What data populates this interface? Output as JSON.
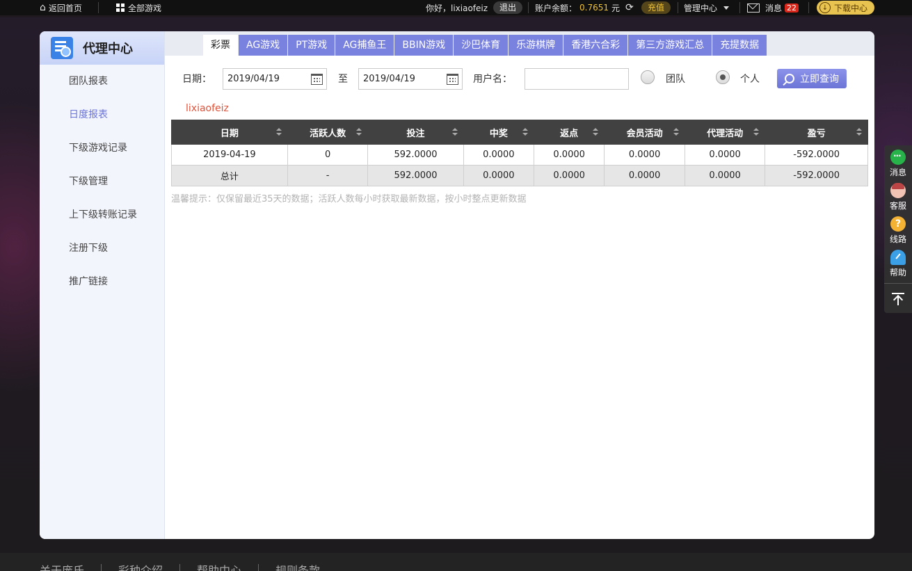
{
  "topbar": {
    "home_label": "返回首页",
    "all_games_label": "全部游戏",
    "greeting": "你好，lixiaofeiz",
    "logout_label": "退出",
    "balance_label": "账户余额：",
    "balance_value": "0.7651",
    "balance_unit": "元",
    "recharge_label": "充值",
    "manage_label": "管理中心",
    "messages_label": "消息",
    "messages_count": "22",
    "download_label": "下载中心"
  },
  "sidebar": {
    "title": "代理中心",
    "items": [
      {
        "label": "团队报表"
      },
      {
        "label": "日度报表"
      },
      {
        "label": "下级游戏记录"
      },
      {
        "label": "下级管理"
      },
      {
        "label": "上下级转账记录"
      },
      {
        "label": "注册下级"
      },
      {
        "label": "推广链接"
      }
    ],
    "active_index": 1
  },
  "tabs": [
    {
      "label": "彩票"
    },
    {
      "label": "AG游戏"
    },
    {
      "label": "PT游戏"
    },
    {
      "label": "AG捕鱼王"
    },
    {
      "label": "BBIN游戏"
    },
    {
      "label": "沙巴体育"
    },
    {
      "label": "乐游棋牌"
    },
    {
      "label": "香港六合彩"
    },
    {
      "label": "第三方游戏汇总"
    },
    {
      "label": "充提数据"
    }
  ],
  "filters": {
    "date_label": "日期：",
    "start_date": "2019/04/19",
    "to_label": "至",
    "end_date": "2019/04/19",
    "username_label": "用户名：",
    "username_value": "",
    "team_label": "团队",
    "personal_label": "个人",
    "selected": "personal",
    "query_label": "立即查询"
  },
  "username_display": "lixiaofeiz",
  "table": {
    "headers": [
      "日期",
      "活跃人数",
      "投注",
      "中奖",
      "返点",
      "会员活动",
      "代理活动",
      "盈亏"
    ],
    "rows": [
      [
        "2019-04-19",
        "0",
        "592.0000",
        "0.0000",
        "0.0000",
        "0.0000",
        "0.0000",
        "-592.0000"
      ]
    ],
    "total": [
      "总计",
      "-",
      "592.0000",
      "0.0000",
      "0.0000",
      "0.0000",
      "0.0000",
      "-592.0000"
    ]
  },
  "tip": "温馨提示：仅保留最近35天的数据；活跃人数每小时获取最新数据，按小时整点更新数据",
  "float_bar": {
    "items": [
      {
        "label": "消息",
        "icon": "chat-icon"
      },
      {
        "label": "客服",
        "icon": "customer-service-icon"
      },
      {
        "label": "线路",
        "icon": "route-icon"
      },
      {
        "label": "帮助",
        "icon": "help-icon"
      }
    ]
  },
  "footer": {
    "links": [
      "关于庞氏",
      "彩种介绍",
      "帮助中心",
      "规则条款"
    ]
  },
  "colors": {
    "accent": "#7a82e0",
    "username": "#e0533a",
    "balance": "#f1c232",
    "table_header": "#414141"
  }
}
